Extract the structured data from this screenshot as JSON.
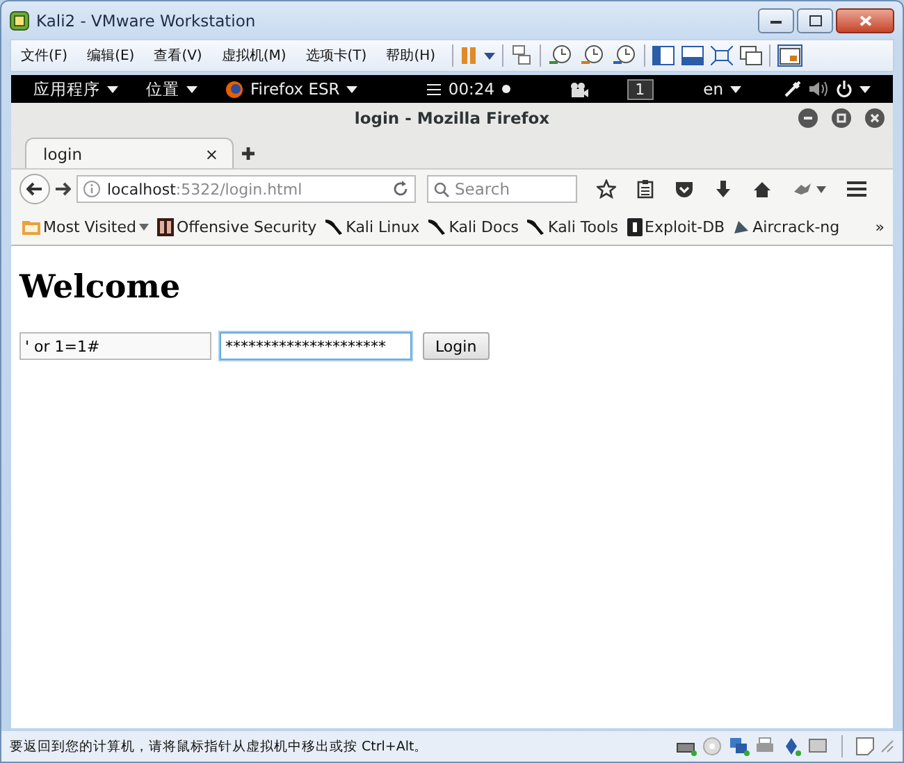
{
  "window": {
    "title": "Kali2 - VMware Workstation"
  },
  "menu": [
    "文件(F)",
    "编辑(E)",
    "查看(V)",
    "虚拟机(M)",
    "选项卡(T)",
    "帮助(H)"
  ],
  "kali_panel": {
    "applications": "应用程序",
    "places": "位置",
    "app": "Firefox ESR",
    "clock": "00:24",
    "workspace": "1",
    "language": "en"
  },
  "firefox": {
    "title": "login - Mozilla Firefox",
    "tabs": [
      {
        "label": "login",
        "selected": true,
        "close": "×"
      }
    ],
    "url_host": "localhost",
    "url_path": ":5322/login.html",
    "search": {
      "placeholder": "Search"
    },
    "bookmarks": [
      {
        "label": "Most Visited",
        "kind": "folder"
      },
      {
        "label": "Offensive Security",
        "kind": "site"
      },
      {
        "label": "Kali Linux",
        "kind": "kali"
      },
      {
        "label": "Kali Docs",
        "kind": "kali"
      },
      {
        "label": "Kali Tools",
        "kind": "kali"
      },
      {
        "label": "Exploit-DB",
        "kind": "exploit"
      },
      {
        "label": "Aircrack-ng",
        "kind": "aircrack"
      }
    ],
    "bookmarks_overflow": "»"
  },
  "page": {
    "heading": "Welcome",
    "username": {
      "value": "' or 1=1#"
    },
    "password": {
      "value": "*********************",
      "focused": true
    },
    "button": "Login"
  },
  "status_bar": "要返回到您的计算机，请将鼠标指针从虚拟机中移出或按 Ctrl+Alt。"
}
